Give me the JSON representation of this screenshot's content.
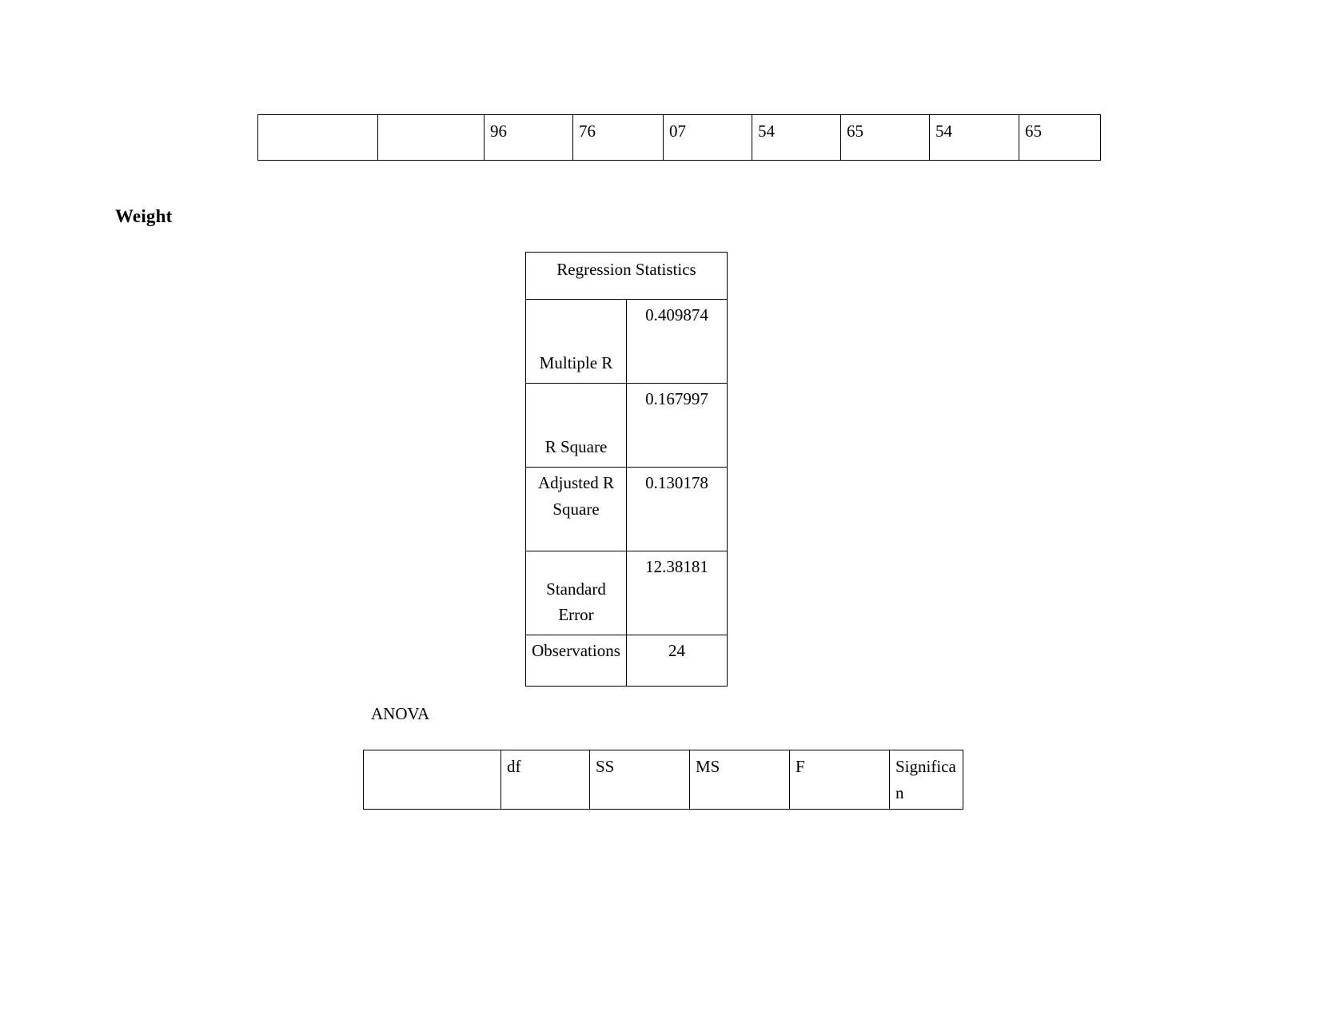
{
  "document": {
    "heading": "Weight",
    "anova_label": "ANOVA"
  },
  "top_table": {
    "rows": [
      [
        "",
        "",
        "96",
        "76",
        "07",
        "54",
        "65",
        "54",
        "65"
      ]
    ]
  },
  "regression_statistics": {
    "title": "Regression Statistics",
    "rows": [
      {
        "label": "Multiple R",
        "value": "0.409874"
      },
      {
        "label": "R Square",
        "value": "0.167997"
      },
      {
        "label": "Adjusted R Square",
        "value": "0.130178"
      },
      {
        "label": "Standard Error",
        "value": "12.38181"
      },
      {
        "label": "Observations",
        "value": "24"
      }
    ]
  },
  "anova_table": {
    "headers": [
      "",
      "df",
      "SS",
      "MS",
      "F",
      "Significan"
    ]
  },
  "colors": {
    "border": "#000000",
    "text": "#000000",
    "background": "#ffffff"
  }
}
